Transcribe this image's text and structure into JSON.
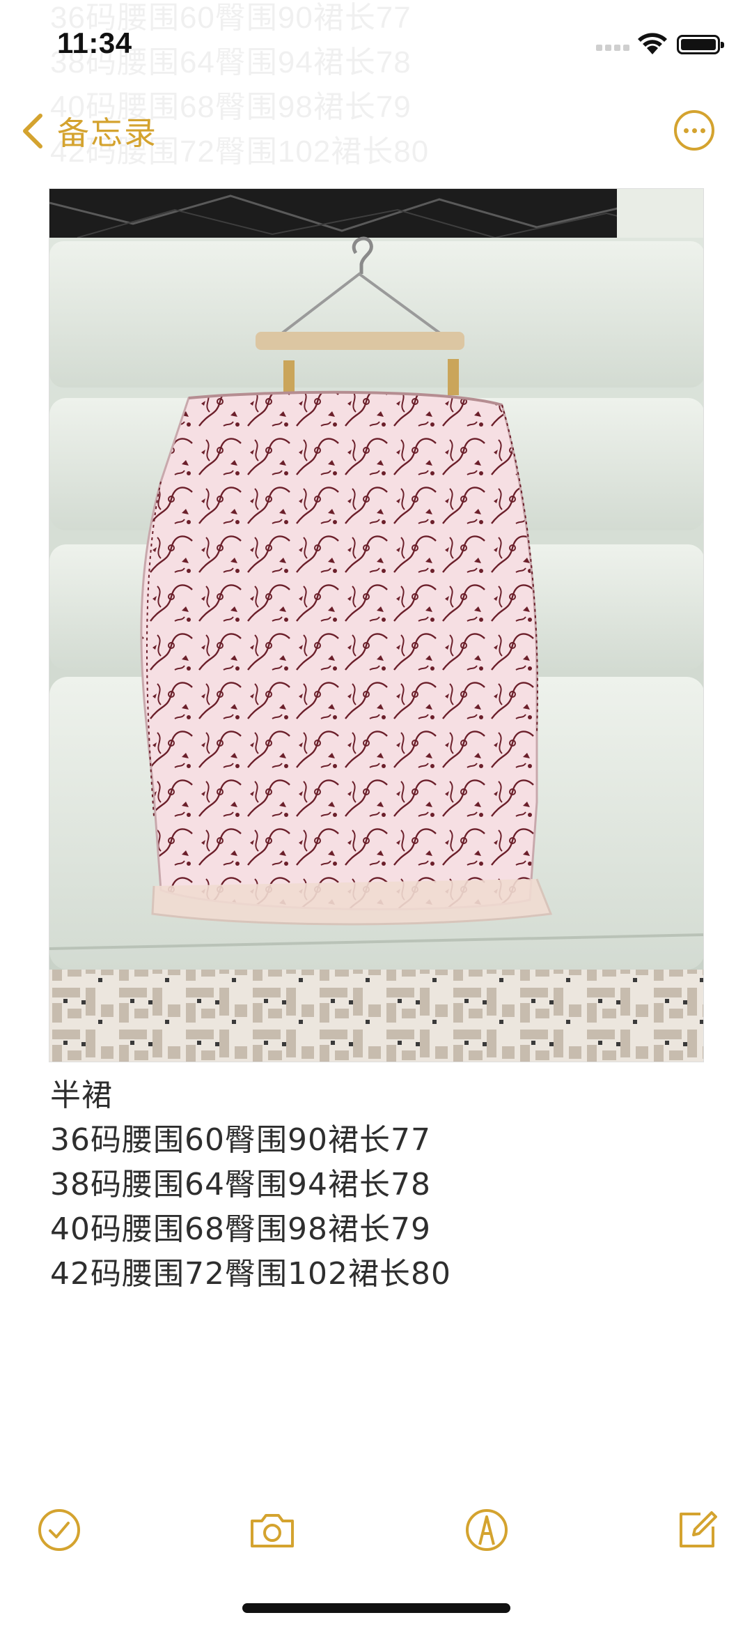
{
  "status_bar": {
    "time": "11:34"
  },
  "nav": {
    "back_label": "备忘录"
  },
  "ghost_text": [
    "36码腰围60臀围90裙长77",
    "38码腰围64臀围94裙长78",
    "40码腰围68臀围98裙长79",
    "42码腰围72臀围102裙长80"
  ],
  "note": {
    "lines": [
      "半裙",
      "36码腰围60臀围90裙长77",
      "38码腰围64臀围94裙长78",
      "40码腰围68臀围98裙长79",
      "42码腰围72臀围102裙长80"
    ]
  },
  "toolbar": {
    "items": [
      "checklist-icon",
      "camera-icon",
      "markup-icon",
      "compose-icon"
    ]
  },
  "colors": {
    "accent": "#d4a32f",
    "text": "#2e2e2e",
    "skirt": "#f6dfe3",
    "print": "#6b1f2a"
  },
  "photo": {
    "alt_icons": [
      "hanger-icon"
    ]
  }
}
